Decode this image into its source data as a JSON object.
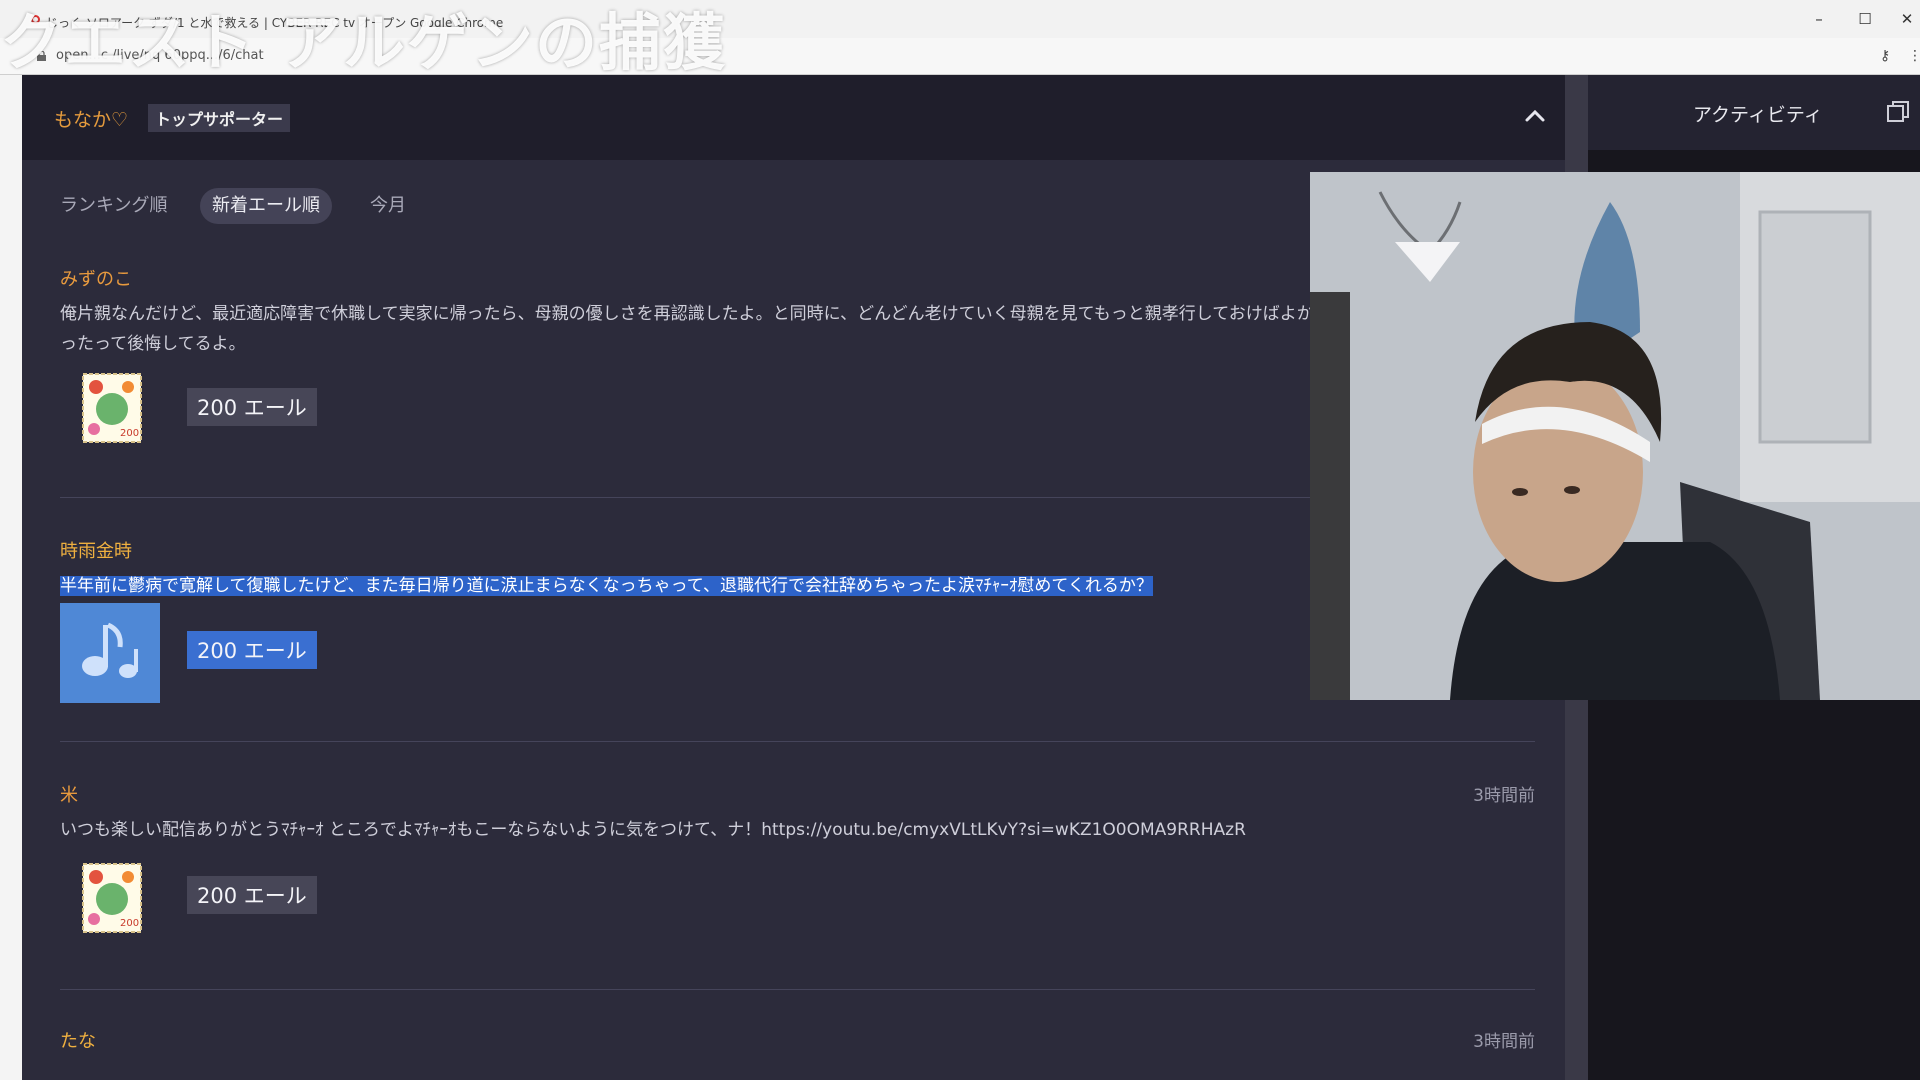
{
  "browser": {
    "tab_title": "じっく ソロアーク ずダ/1 と水で救える | CYBER REC tv オープン Google Chrome",
    "url": "open...c /live/nq 60ppq.../6/chat",
    "window_controls": {
      "minimize": "–",
      "maximize": "☐",
      "close": "✕"
    }
  },
  "overlay": {
    "title": "クエスト アルゲンの捕獲"
  },
  "panel": {
    "supporter_name": "もなか♡",
    "supporter_badge": "トップサポーター",
    "tabs": [
      {
        "label": "ランキング順",
        "active": false
      },
      {
        "label": "新着エール順",
        "active": true
      },
      {
        "label": "今月",
        "active": false
      }
    ]
  },
  "feed": [
    {
      "user": "みずのこ",
      "time": "",
      "message": "俺片親なんだけど、最近適応障害で休職して実家に帰ったら、母親の優しさを再認識したよ。と同時に、どんどん老けていく母親を見てもっと親孝行しておけばよかったって後悔してるよ。",
      "gift": "stamp",
      "amount": "200 エール"
    },
    {
      "user": "時雨金時",
      "time": "",
      "message": "半年前に鬱病で寛解して復職したけど、また毎日帰り道に涙止まらなくなっちゃって、退職代行で会社辞めちゃったよ涙ﾏﾁｬｰｵ慰めてくれるか？",
      "gift": "music",
      "amount": "200 エール"
    },
    {
      "user": "米",
      "time": "3時間前",
      "message": "いつも楽しい配信ありがとうﾏﾁｬｰｵ ところでよﾏﾁｬｰｵもこーならないように気をつけて、ナ！https://youtu.be/cmyxVLtLKvY?si=wKZ1O0OMA9RRHAzR",
      "gift": "stamp",
      "amount": "200 エール"
    },
    {
      "user": "たな",
      "time": "3時間前",
      "message": "",
      "gift": "",
      "amount": ""
    }
  ],
  "sidebar": {
    "activity_label": "アクティビティ"
  },
  "colors": {
    "accent_orange": "#e89a3e",
    "panel_bg": "#2c2b3b",
    "header_bg": "#1f1e2b",
    "selection": "#2d63c9"
  }
}
